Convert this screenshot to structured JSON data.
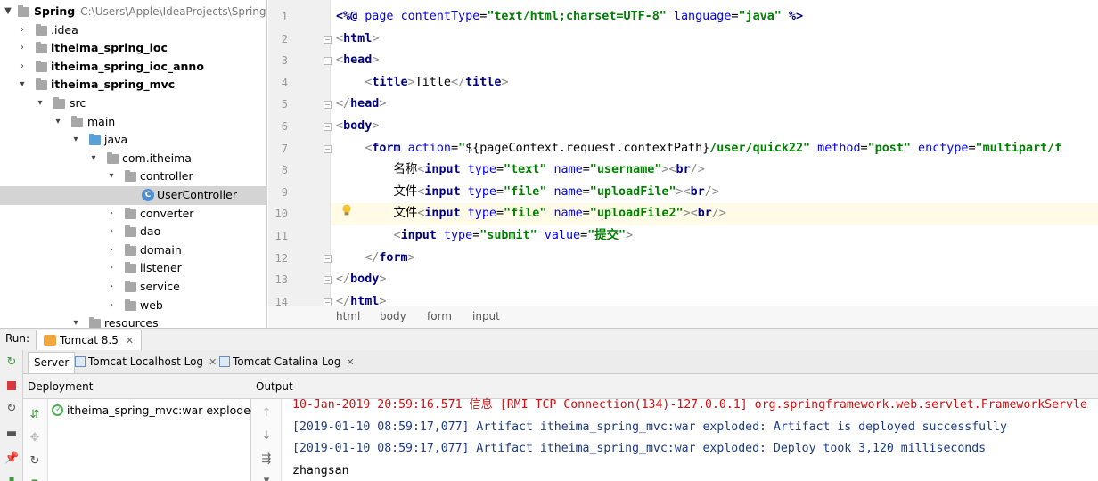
{
  "project": {
    "root": {
      "name": "Spring",
      "path": "C:\\Users\\Apple\\IdeaProjects\\Spring"
    },
    "items": [
      {
        "label": ".idea"
      },
      {
        "label": "itheima_spring_ioc"
      },
      {
        "label": "itheima_spring_ioc_anno"
      },
      {
        "label": "itheima_spring_mvc"
      },
      {
        "label": "src"
      },
      {
        "label": "main"
      },
      {
        "label": "java"
      },
      {
        "label": "com.itheima"
      },
      {
        "label": "controller"
      },
      {
        "label": "UserController"
      },
      {
        "label": "converter"
      },
      {
        "label": "dao"
      },
      {
        "label": "domain"
      },
      {
        "label": "listener"
      },
      {
        "label": "service"
      },
      {
        "label": "web"
      },
      {
        "label": "resources"
      }
    ]
  },
  "editor": {
    "line_numbers": [
      "1",
      "2",
      "3",
      "4",
      "5",
      "6",
      "7",
      "8",
      "9",
      "10",
      "11",
      "12",
      "13",
      "14"
    ],
    "lines": [
      [
        [
          "dc",
          "<%@ "
        ],
        [
          "at",
          "page "
        ],
        [
          "at",
          "contentType"
        ],
        [
          "black",
          "="
        ],
        [
          "st",
          "\"text/html;charset=UTF-8\""
        ],
        [
          "at",
          " language"
        ],
        [
          "black",
          "="
        ],
        [
          "st",
          "\"java\""
        ],
        [
          "dc",
          " %>"
        ]
      ],
      [
        [
          "br",
          "<"
        ],
        [
          "tg",
          "html"
        ],
        [
          "br",
          ">"
        ]
      ],
      [
        [
          "br",
          "<"
        ],
        [
          "tg",
          "head"
        ],
        [
          "br",
          ">"
        ]
      ],
      [
        [
          "black",
          "    "
        ],
        [
          "br",
          "<"
        ],
        [
          "tg",
          "title"
        ],
        [
          "br",
          ">"
        ],
        [
          "black",
          "Title"
        ],
        [
          "br",
          "</"
        ],
        [
          "tg",
          "title"
        ],
        [
          "br",
          ">"
        ]
      ],
      [
        [
          "br",
          "</"
        ],
        [
          "tg",
          "head"
        ],
        [
          "br",
          ">"
        ]
      ],
      [
        [
          "br",
          "<"
        ],
        [
          "tg",
          "body"
        ],
        [
          "br",
          ">"
        ]
      ],
      [
        [
          "black",
          "    "
        ],
        [
          "br",
          "<"
        ],
        [
          "tg",
          "form "
        ],
        [
          "at",
          "action"
        ],
        [
          "black",
          "="
        ],
        [
          "st",
          "\""
        ],
        [
          "black",
          "${pageContext.request.contextPath}"
        ],
        [
          "st",
          "/user/quick22\""
        ],
        [
          "at",
          " method"
        ],
        [
          "black",
          "="
        ],
        [
          "st",
          "\"post\""
        ],
        [
          "at",
          " enctype"
        ],
        [
          "black",
          "="
        ],
        [
          "st",
          "\"multipart/f"
        ]
      ],
      [
        [
          "black",
          "        名称"
        ],
        [
          "br",
          "<"
        ],
        [
          "tg",
          "input "
        ],
        [
          "at",
          "type"
        ],
        [
          "black",
          "="
        ],
        [
          "st",
          "\"text\""
        ],
        [
          "at",
          " name"
        ],
        [
          "black",
          "="
        ],
        [
          "st",
          "\"username\""
        ],
        [
          "br",
          ">"
        ],
        [
          "br",
          "<"
        ],
        [
          "tg",
          "br"
        ],
        [
          "br",
          "/>"
        ]
      ],
      [
        [
          "black",
          "        文件"
        ],
        [
          "br",
          "<"
        ],
        [
          "tg",
          "input "
        ],
        [
          "at",
          "type"
        ],
        [
          "black",
          "="
        ],
        [
          "st",
          "\"file\""
        ],
        [
          "at",
          " name"
        ],
        [
          "black",
          "="
        ],
        [
          "st",
          "\"uploadFile\""
        ],
        [
          "br",
          ">"
        ],
        [
          "br",
          "<"
        ],
        [
          "tg",
          "br"
        ],
        [
          "br",
          "/>"
        ]
      ],
      [
        [
          "black",
          "        文件"
        ],
        [
          "br",
          "<"
        ],
        [
          "tg",
          "input "
        ],
        [
          "at",
          "type"
        ],
        [
          "black",
          "="
        ],
        [
          "st",
          "\"file\""
        ],
        [
          "at",
          " name"
        ],
        [
          "black",
          "="
        ],
        [
          "st",
          "\"uploadFile2\""
        ],
        [
          "br",
          ">"
        ],
        [
          "br",
          "<"
        ],
        [
          "tg",
          "br"
        ],
        [
          "br",
          "/>"
        ]
      ],
      [
        [
          "black",
          "        "
        ],
        [
          "br",
          "<"
        ],
        [
          "tg",
          "input "
        ],
        [
          "at",
          "type"
        ],
        [
          "black",
          "="
        ],
        [
          "st",
          "\"submit\""
        ],
        [
          "at",
          " value"
        ],
        [
          "black",
          "="
        ],
        [
          "st",
          "\"提交\""
        ],
        [
          "br",
          ">"
        ]
      ],
      [
        [
          "black",
          "    "
        ],
        [
          "br",
          "</"
        ],
        [
          "tg",
          "form"
        ],
        [
          "br",
          ">"
        ]
      ],
      [
        [
          "br",
          "</"
        ],
        [
          "tg",
          "body"
        ],
        [
          "br",
          ">"
        ]
      ],
      [
        [
          "br",
          "</"
        ],
        [
          "tg",
          "html"
        ],
        [
          "br",
          ">"
        ]
      ]
    ],
    "breadcrumb": [
      "html",
      "body",
      "form",
      "input"
    ]
  },
  "run": {
    "label": "Run:",
    "config": "Tomcat 8.5",
    "tabs": [
      {
        "label": "Server"
      },
      {
        "label": "Tomcat Localhost Log"
      },
      {
        "label": "Tomcat Catalina Log"
      }
    ],
    "deployment_header": "Deployment",
    "deployment_item": "itheima_spring_mvc:war exploded",
    "output_header": "Output",
    "output_lines": [
      "10-Jan-2019 20:59:16.571 信息 [RMI TCP Connection(134)-127.0.0.1] org.springframework.web.servlet.FrameworkServle",
      "[2019-01-10 08:59:17,077] Artifact itheima_spring_mvc:war exploded: Artifact is deployed successfully",
      "[2019-01-10 08:59:17,077] Artifact itheima_spring_mvc:war exploded: Deploy took 3,120 milliseconds",
      "zhangsan"
    ]
  }
}
